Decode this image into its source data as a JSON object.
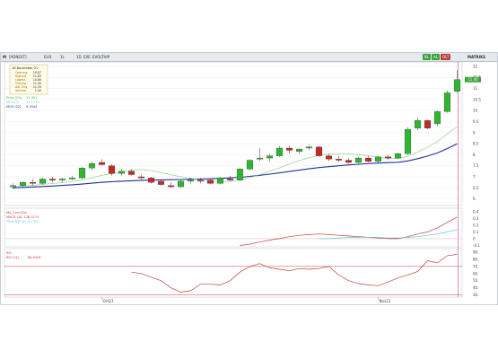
{
  "toolbar": {
    "menu_icon": "M",
    "symbol": "[ADNEXT]",
    "currency": "EUR",
    "interval": "1L",
    "period": "1D",
    "mode": "EXE",
    "style": "EVOLTHIP",
    "buttons": [
      "BL",
      "AL",
      "OLT"
    ],
    "right_label": "MATRIKS"
  },
  "chart_data": {
    "type": "candlestick",
    "infobox": {
      "title": "18 November 21",
      "rows": [
        {
          "label": "Opening",
          "value": "10.87"
        },
        {
          "label": "Highest",
          "value": "11.83"
        },
        {
          "label": "Lowest",
          "value": "10.80"
        },
        {
          "label": "Closing",
          "value": "11.40"
        },
        {
          "label": "Adj. Chg",
          "value": "11.33"
        },
        {
          "label": "Volume",
          "value": "1.40"
        }
      ]
    },
    "legend_price": [
      {
        "name": "Price (Ch)",
        "value": "11.351",
        "color": "#3fae3f"
      },
      {
        "name": "MOV (7)",
        "value": "10.1772",
        "color": "#7fd07f"
      },
      {
        "name": "MOV (22)",
        "value": "9.3044",
        "color": "#1f2f9a"
      }
    ],
    "legend_macd": [
      {
        "name": "MA_Conv.Div.",
        "value": "",
        "color": "#c04040"
      },
      {
        "name": "MACD (26, 12)",
        "value": "0.3174",
        "color": "#c04040"
      },
      {
        "name": "TRIGGER (9)",
        "value": "0.1301",
        "color": "#5fc6d8"
      }
    ],
    "legend_rsi": [
      {
        "name": "RSI",
        "value": "",
        "color": "#c04040"
      },
      {
        "name": "RSI (14)",
        "value": "86.9428",
        "color": "#c04040"
      }
    ],
    "price_axis": {
      "ticks": [
        "12.",
        "11.5",
        "11",
        "10.5",
        "10.",
        "9.5",
        "9",
        "8.5",
        "8.",
        "7.5",
        "7",
        "6.5",
        "6."
      ],
      "min": 5.7,
      "max": 12.2
    },
    "last_price_label": "11.40",
    "macd_axis": {
      "ticks": [
        "0.4",
        "0.3",
        "0.2",
        "0.1",
        "0",
        "-0.1"
      ],
      "min": -0.12,
      "max": 0.45
    },
    "rsi_axis": {
      "ticks": [
        "90.",
        "80.",
        "70.",
        "60.",
        "50.",
        "40.",
        "30."
      ],
      "min": 27,
      "max": 95,
      "lines": [
        70,
        30
      ]
    },
    "x_labels": [
      {
        "label": "Oct21",
        "index": 9
      },
      {
        "label": "Nov21",
        "index": 37
      }
    ],
    "candles": [
      {
        "o": 6.55,
        "h": 6.7,
        "l": 6.45,
        "c": 6.6
      },
      {
        "o": 6.6,
        "h": 6.8,
        "l": 6.55,
        "c": 6.75
      },
      {
        "o": 6.75,
        "h": 6.9,
        "l": 6.6,
        "c": 6.7
      },
      {
        "o": 6.7,
        "h": 6.95,
        "l": 6.65,
        "c": 6.9
      },
      {
        "o": 6.9,
        "h": 7.0,
        "l": 6.75,
        "c": 6.85
      },
      {
        "o": 6.85,
        "h": 6.95,
        "l": 6.75,
        "c": 6.9
      },
      {
        "o": 6.9,
        "h": 7.05,
        "l": 6.85,
        "c": 6.95
      },
      {
        "o": 6.95,
        "h": 7.45,
        "l": 6.9,
        "c": 7.4
      },
      {
        "o": 7.4,
        "h": 7.7,
        "l": 7.3,
        "c": 7.6
      },
      {
        "o": 7.65,
        "h": 7.8,
        "l": 7.5,
        "c": 7.55
      },
      {
        "o": 7.5,
        "h": 7.6,
        "l": 7.05,
        "c": 7.15
      },
      {
        "o": 7.15,
        "h": 7.35,
        "l": 7.05,
        "c": 7.25
      },
      {
        "o": 7.25,
        "h": 7.35,
        "l": 7.05,
        "c": 7.1
      },
      {
        "o": 7.0,
        "h": 7.1,
        "l": 6.85,
        "c": 6.95
      },
      {
        "o": 6.95,
        "h": 7.0,
        "l": 6.7,
        "c": 6.75
      },
      {
        "o": 6.8,
        "h": 6.85,
        "l": 6.6,
        "c": 6.65
      },
      {
        "o": 6.6,
        "h": 6.75,
        "l": 6.5,
        "c": 6.55
      },
      {
        "o": 6.55,
        "h": 6.85,
        "l": 6.5,
        "c": 6.8
      },
      {
        "o": 6.8,
        "h": 6.95,
        "l": 6.7,
        "c": 6.85
      },
      {
        "o": 6.85,
        "h": 6.95,
        "l": 6.7,
        "c": 6.8
      },
      {
        "o": 6.85,
        "h": 6.9,
        "l": 6.65,
        "c": 6.7
      },
      {
        "o": 6.7,
        "h": 7.0,
        "l": 6.65,
        "c": 6.95
      },
      {
        "o": 6.9,
        "h": 7.05,
        "l": 6.8,
        "c": 6.85
      },
      {
        "o": 6.85,
        "h": 7.4,
        "l": 6.8,
        "c": 7.35
      },
      {
        "o": 7.35,
        "h": 7.8,
        "l": 7.3,
        "c": 7.75
      },
      {
        "o": 7.8,
        "h": 8.3,
        "l": 7.7,
        "c": 7.85
      },
      {
        "o": 7.85,
        "h": 8.05,
        "l": 7.7,
        "c": 7.95
      },
      {
        "o": 7.95,
        "h": 8.4,
        "l": 7.9,
        "c": 8.3
      },
      {
        "o": 8.3,
        "h": 8.4,
        "l": 8.05,
        "c": 8.2
      },
      {
        "o": 8.15,
        "h": 8.3,
        "l": 8.05,
        "c": 8.25
      },
      {
        "o": 8.3,
        "h": 8.45,
        "l": 8.2,
        "c": 8.35
      },
      {
        "o": 8.35,
        "h": 8.4,
        "l": 7.9,
        "c": 7.95
      },
      {
        "o": 7.95,
        "h": 8.05,
        "l": 7.7,
        "c": 7.8
      },
      {
        "o": 7.8,
        "h": 7.95,
        "l": 7.65,
        "c": 7.75
      },
      {
        "o": 7.75,
        "h": 7.85,
        "l": 7.6,
        "c": 7.65
      },
      {
        "o": 7.65,
        "h": 7.9,
        "l": 7.6,
        "c": 7.85
      },
      {
        "o": 7.85,
        "h": 7.95,
        "l": 7.65,
        "c": 7.7
      },
      {
        "o": 7.7,
        "h": 7.95,
        "l": 7.65,
        "c": 7.9
      },
      {
        "o": 7.9,
        "h": 8.0,
        "l": 7.75,
        "c": 7.85
      },
      {
        "o": 7.85,
        "h": 8.1,
        "l": 7.8,
        "c": 8.05
      },
      {
        "o": 8.05,
        "h": 9.25,
        "l": 8.0,
        "c": 9.15
      },
      {
        "o": 9.2,
        "h": 9.7,
        "l": 9.1,
        "c": 9.55
      },
      {
        "o": 9.55,
        "h": 9.6,
        "l": 9.15,
        "c": 9.2
      },
      {
        "o": 9.4,
        "h": 10.0,
        "l": 9.3,
        "c": 9.95
      },
      {
        "o": 9.95,
        "h": 10.9,
        "l": 9.9,
        "c": 10.8
      },
      {
        "o": 10.87,
        "h": 11.83,
        "l": 10.8,
        "c": 11.4
      }
    ],
    "ma7": [
      6.55,
      6.58,
      6.62,
      6.66,
      6.7,
      6.74,
      6.79,
      6.85,
      6.95,
      7.07,
      7.14,
      7.22,
      7.3,
      7.33,
      7.28,
      7.19,
      7.09,
      7.01,
      6.93,
      6.85,
      6.8,
      6.78,
      6.79,
      6.86,
      6.96,
      7.1,
      7.25,
      7.4,
      7.58,
      7.74,
      7.86,
      7.98,
      8.03,
      8.05,
      8.03,
      8.0,
      7.95,
      7.88,
      7.84,
      7.83,
      7.93,
      8.13,
      8.34,
      8.6,
      8.94,
      9.27
    ],
    "ma22": [
      6.5,
      6.52,
      6.54,
      6.56,
      6.58,
      6.61,
      6.64,
      6.67,
      6.71,
      6.75,
      6.78,
      6.8,
      6.82,
      6.84,
      6.85,
      6.86,
      6.87,
      6.88,
      6.89,
      6.9,
      6.91,
      6.93,
      6.95,
      6.98,
      7.02,
      7.07,
      7.12,
      7.18,
      7.24,
      7.3,
      7.36,
      7.42,
      7.46,
      7.5,
      7.54,
      7.57,
      7.6,
      7.62,
      7.64,
      7.66,
      7.72,
      7.82,
      7.94,
      8.08,
      8.28,
      8.5
    ],
    "macd": [
      null,
      null,
      null,
      null,
      null,
      null,
      null,
      null,
      null,
      null,
      null,
      null,
      null,
      null,
      null,
      null,
      null,
      null,
      null,
      null,
      null,
      null,
      null,
      -0.1,
      -0.08,
      -0.05,
      -0.02,
      0.0,
      0.03,
      0.05,
      0.06,
      0.07,
      0.06,
      0.05,
      0.04,
      0.03,
      0.02,
      0.01,
      0.0,
      0.0,
      0.03,
      0.07,
      0.1,
      0.16,
      0.24,
      0.32
    ],
    "trigger": [
      null,
      null,
      null,
      null,
      null,
      null,
      null,
      null,
      null,
      null,
      null,
      null,
      null,
      null,
      null,
      null,
      null,
      null,
      null,
      null,
      null,
      null,
      null,
      null,
      null,
      null,
      null,
      null,
      null,
      null,
      null,
      0.0,
      0.0,
      0.01,
      0.02,
      0.02,
      0.02,
      0.02,
      0.01,
      0.01,
      0.02,
      0.03,
      0.05,
      0.07,
      0.1,
      0.13
    ],
    "rsi": [
      null,
      null,
      null,
      null,
      null,
      null,
      null,
      null,
      null,
      null,
      null,
      null,
      null,
      null,
      null,
      null,
      null,
      null,
      null,
      null,
      null,
      null,
      null,
      null,
      null,
      null,
      null,
      null,
      null,
      null,
      null,
      null,
      null,
      null,
      null,
      null,
      null,
      null,
      null,
      null,
      null,
      null,
      null,
      null,
      null,
      null
    ]
  },
  "rsi_values": [
    null,
    null,
    null,
    null,
    null,
    null,
    null,
    null,
    null,
    null,
    null,
    null,
    62,
    60,
    55,
    50,
    40,
    34,
    36,
    45,
    45,
    44,
    50,
    62,
    70,
    74,
    68,
    66,
    64,
    67,
    66,
    67,
    70,
    58,
    50,
    46,
    44,
    43,
    48,
    54,
    58,
    63,
    78,
    75,
    85,
    87
  ]
}
